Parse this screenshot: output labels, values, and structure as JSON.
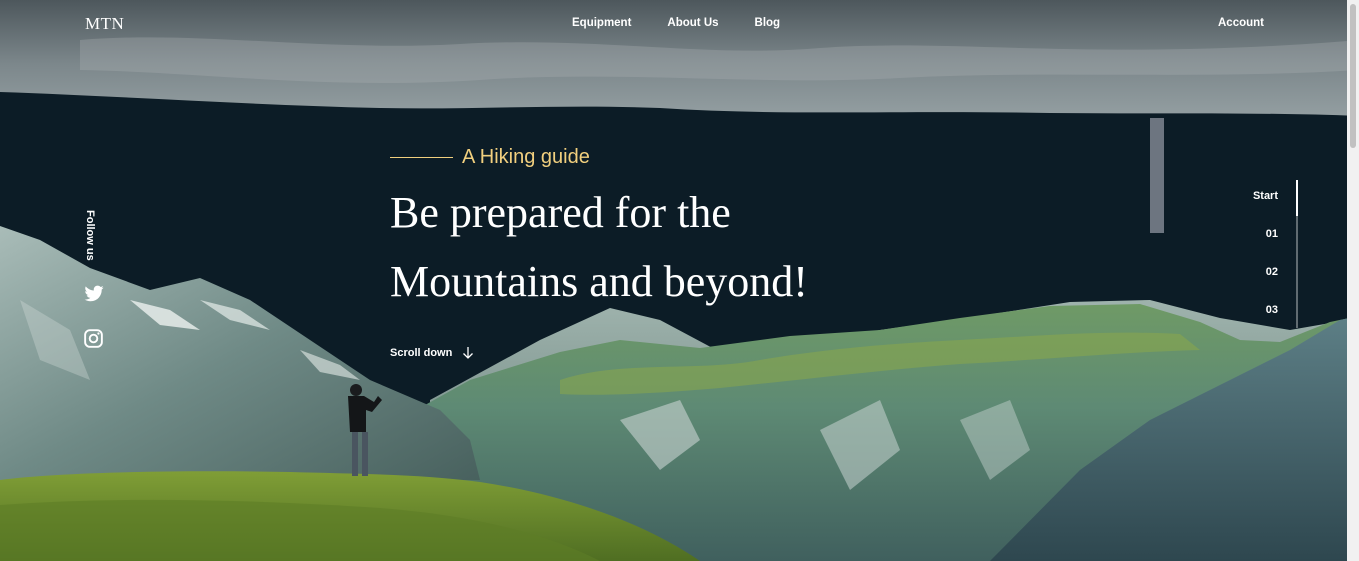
{
  "header": {
    "logo": "MTN",
    "nav": [
      "Equipment",
      "About Us",
      "Blog"
    ],
    "account": "Account"
  },
  "hero": {
    "eyebrow": "A Hiking guide",
    "headline_line1": "Be prepared for the",
    "headline_line2": "Mountains and beyond!",
    "scroll_label": "Scroll down"
  },
  "social": {
    "follow_label": "Follow us",
    "icons": [
      "twitter-icon",
      "instagram-icon"
    ]
  },
  "sections": {
    "items": [
      "Start",
      "01",
      "02",
      "03"
    ],
    "active_index": 0
  },
  "colors": {
    "accent": "#f1cf7e",
    "sky": "#0c1c26",
    "grass": "#6f8f2c",
    "mountain": "#5f7f78"
  }
}
